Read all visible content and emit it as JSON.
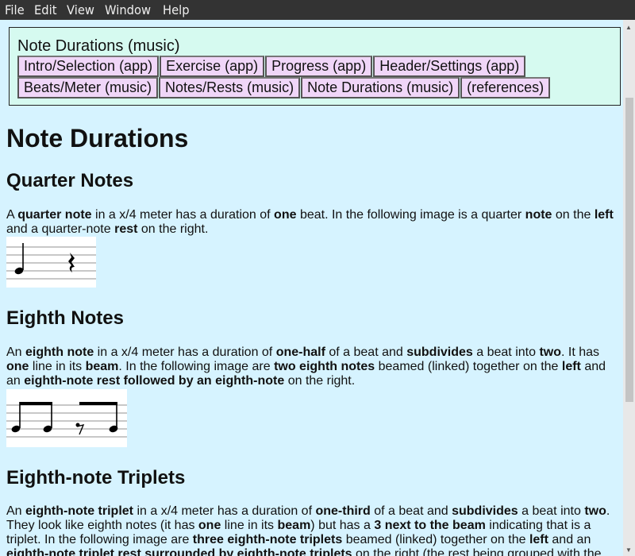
{
  "menu": [
    "File",
    "Edit",
    "View",
    "Window",
    "Help"
  ],
  "nav": {
    "title": "Note Durations (music)",
    "row1": [
      "Intro/Selection (app)",
      "Exercise (app)",
      "Progress (app)",
      "Header/Settings (app)"
    ],
    "row2": [
      "Beats/Meter (music)",
      "Notes/Rests (music)",
      "Note Durations (music)",
      "(references)"
    ]
  },
  "page": {
    "title": "Note Durations",
    "sections": [
      {
        "heading": "Quarter Notes",
        "para": [
          [
            "A ",
            0
          ],
          [
            "quarter note",
            1
          ],
          [
            " in a x/4 meter has a duration of ",
            0
          ],
          [
            "one",
            1
          ],
          [
            " beat. In the following image is a quarter ",
            0
          ],
          [
            "note",
            1
          ],
          [
            " on the ",
            0
          ],
          [
            "left",
            1
          ],
          [
            " and a quarter-note ",
            0
          ],
          [
            "rest",
            1
          ],
          [
            " on the right.",
            0
          ]
        ]
      },
      {
        "heading": "Eighth Notes",
        "para": [
          [
            "An ",
            0
          ],
          [
            "eighth note",
            1
          ],
          [
            " in a x/4 meter has a duration of ",
            0
          ],
          [
            "one-half",
            1
          ],
          [
            " of a beat and ",
            0
          ],
          [
            "subdivides",
            1
          ],
          [
            " a beat into ",
            0
          ],
          [
            "two",
            1
          ],
          [
            ". It has ",
            0
          ],
          [
            "one",
            1
          ],
          [
            " line in its ",
            0
          ],
          [
            "beam",
            1
          ],
          [
            ". In the following image are ",
            0
          ],
          [
            "two eighth notes",
            1
          ],
          [
            " beamed (linked) together on the ",
            0
          ],
          [
            "left",
            1
          ],
          [
            " and an ",
            0
          ],
          [
            "eighth-note rest followed by an eighth-note",
            1
          ],
          [
            " on the right.",
            0
          ]
        ]
      },
      {
        "heading": "Eighth-note Triplets",
        "para": [
          [
            "An ",
            0
          ],
          [
            "eighth-note triplet",
            1
          ],
          [
            " in a x/4 meter has a duration of ",
            0
          ],
          [
            "one-third",
            1
          ],
          [
            " of a beat and ",
            0
          ],
          [
            "subdivides",
            1
          ],
          [
            " a beat into ",
            0
          ],
          [
            "two",
            1
          ],
          [
            ". They look like eighth notes (it has ",
            0
          ],
          [
            "one",
            1
          ],
          [
            " line in its ",
            0
          ],
          [
            "beam",
            1
          ],
          [
            ") but has a ",
            0
          ],
          [
            "3 next to the beam",
            1
          ],
          [
            " indicating that is a triplet. In the following image are ",
            0
          ],
          [
            "three eighth-note triplets",
            1
          ],
          [
            " beamed (linked) together on the ",
            0
          ],
          [
            "left",
            1
          ],
          [
            " and an ",
            0
          ],
          [
            "eighth-note triplet rest surrounded by eighth-note triplets",
            1
          ],
          [
            " on the right (the rest being grouped with the",
            0
          ]
        ]
      }
    ]
  }
}
